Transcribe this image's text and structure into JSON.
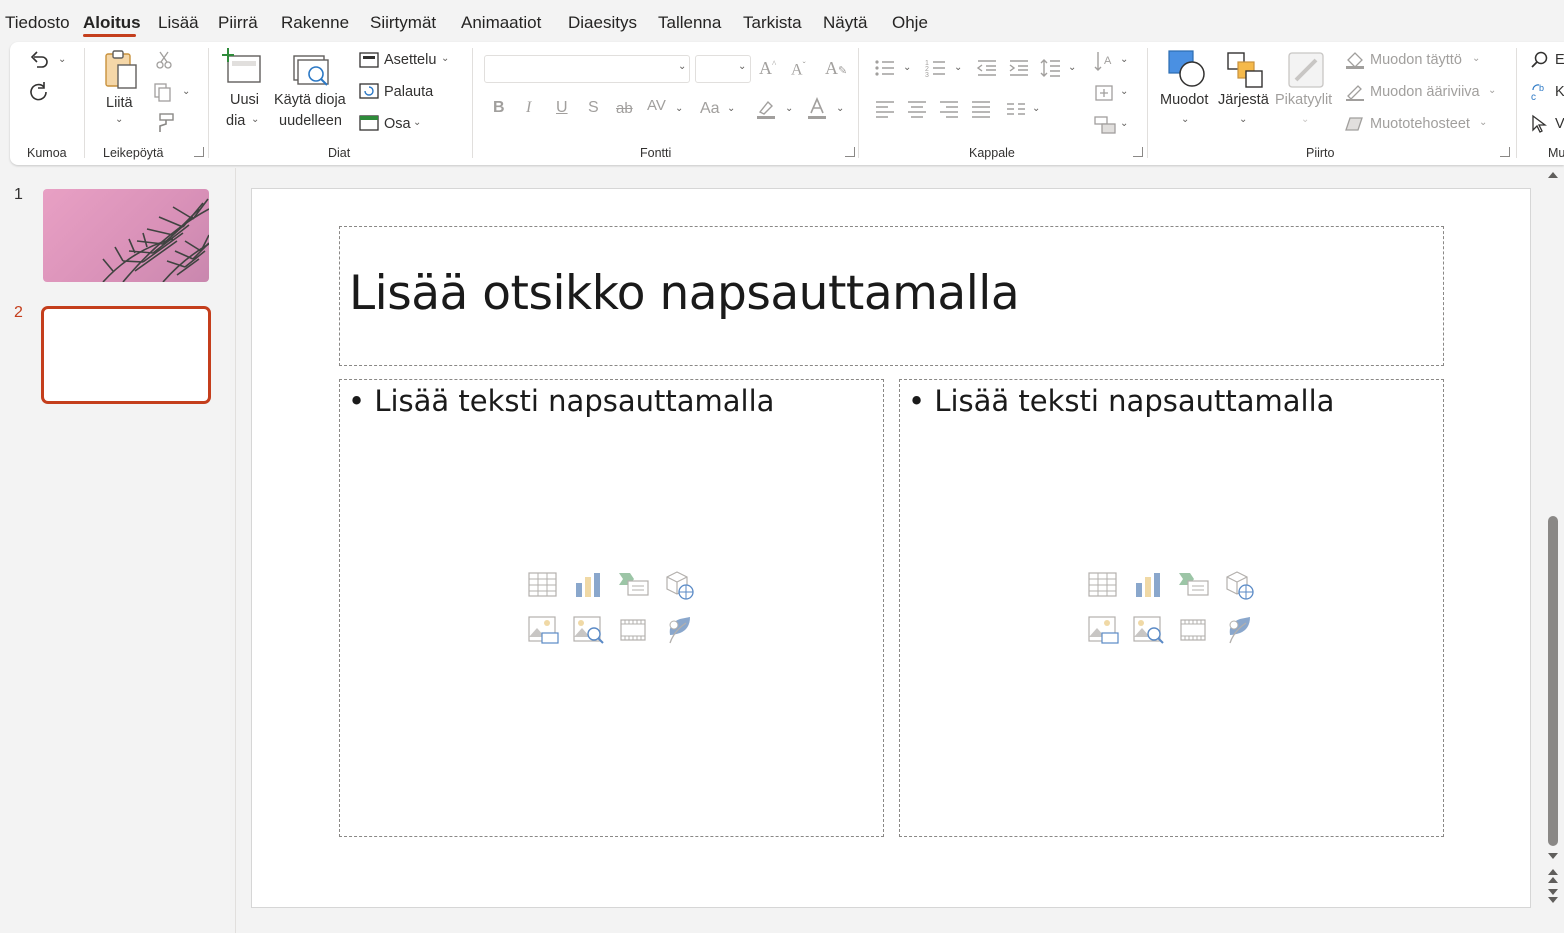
{
  "menu": {
    "tabs": [
      "Tiedosto",
      "Aloitus",
      "Lisää",
      "Piirrä",
      "Rakenne",
      "Siirtymät",
      "Animaatiot",
      "Diaesitys",
      "Tallenna",
      "Tarkista",
      "Näytä",
      "Ohje"
    ],
    "active_tab": "Aloitus"
  },
  "ribbon": {
    "undo_group": {
      "label": "Kumoa"
    },
    "clipboard": {
      "paste": "Liitä",
      "label": "Leikepöytä"
    },
    "slides": {
      "new_slide_1": "Uusi",
      "new_slide_2": "dia",
      "reuse_1": "Käytä dioja",
      "reuse_2": "uudelleen",
      "layout": "Asettelu",
      "reset": "Palauta",
      "section": "Osa",
      "label": "Diat"
    },
    "font": {
      "label": "Fontti",
      "bold": "B",
      "italic": "I",
      "underline": "U",
      "shadow": "S",
      "strike": "ab",
      "spacing": "AV",
      "case": "Aa"
    },
    "paragraph": {
      "label": "Kappale"
    },
    "drawing": {
      "shapes": "Muodot",
      "arrange": "Järjestä",
      "quick_styles": "Pikatyylit",
      "shape_fill": "Muodon täyttö",
      "shape_outline": "Muodon ääriviiva",
      "shape_effects": "Muototehosteet",
      "label": "Piirto"
    },
    "editing": {
      "find": "E",
      "replace": "K",
      "select": "V",
      "label": "Mu"
    }
  },
  "thumbnails": [
    {
      "number": "1"
    },
    {
      "number": "2",
      "selected": true
    }
  ],
  "slide": {
    "title_placeholder": "Lisää otsikko napsauttamalla",
    "left_content": "• Lisää teksti napsauttamalla",
    "right_content": "• Lisää teksti napsauttamalla"
  },
  "colors": {
    "accent": "#c43e1c",
    "ribbon_bg": "#ffffff",
    "app_bg": "#f3f3f3"
  }
}
